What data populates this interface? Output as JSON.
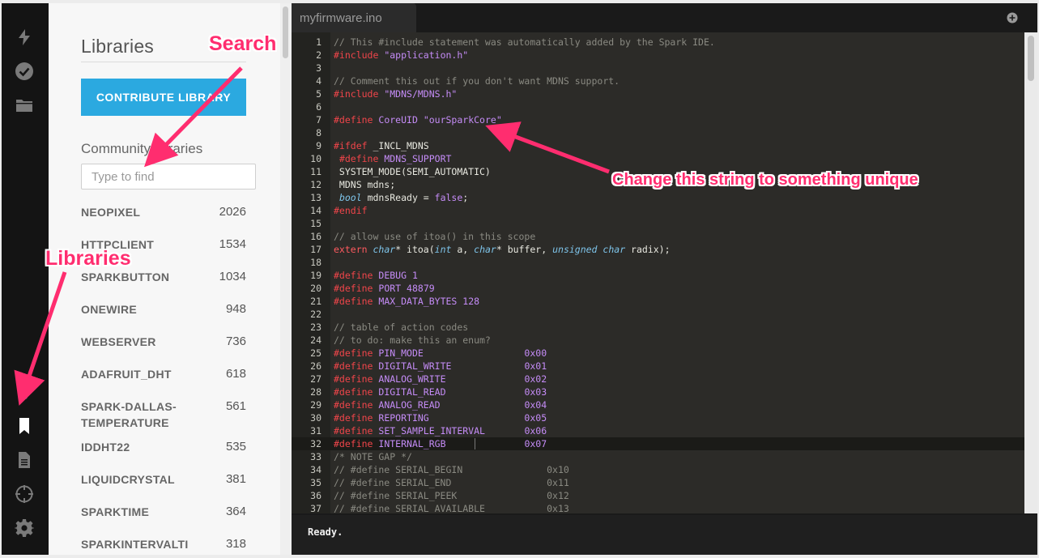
{
  "sidebar": {
    "icons": [
      "flash-icon",
      "verify-check-icon",
      "folder-icon",
      "collapse-chevron-icon",
      "libraries-bookmark-icon",
      "docs-file-icon",
      "target-crosshair-icon",
      "settings-gear-icon"
    ]
  },
  "libraries": {
    "title": "Libraries",
    "contribute_label": "CONTRIBUTE LIBRARY",
    "community_label": "Community libraries",
    "search_placeholder": "Type to find",
    "items": [
      {
        "name": "NEOPIXEL",
        "count": "2026"
      },
      {
        "name": "HTTPCLIENT",
        "count": "1534"
      },
      {
        "name": "SPARKBUTTON",
        "count": "1034"
      },
      {
        "name": "ONEWIRE",
        "count": "948"
      },
      {
        "name": "WEBSERVER",
        "count": "736"
      },
      {
        "name": "ADAFRUIT_DHT",
        "count": "618"
      },
      {
        "name": "SPARK-DALLAS-TEMPERATURE",
        "count": "561"
      },
      {
        "name": "IDDHT22",
        "count": "535"
      },
      {
        "name": "LIQUIDCRYSTAL",
        "count": "381"
      },
      {
        "name": "SPARKTIME",
        "count": "364"
      },
      {
        "name": "SPARKINTERVALTI",
        "count": "318"
      }
    ]
  },
  "editor": {
    "tab_label": "myfirmware.ino",
    "status": "Ready.",
    "lines": [
      "// This #include statement was automatically added by the Spark IDE.",
      "#include \"application.h\"",
      "",
      "// Comment this out if you don't want MDNS support.",
      "#include \"MDNS/MDNS.h\"",
      "",
      "#define CoreUID \"ourSparkCore\"",
      "",
      "#ifdef _INCL_MDNS",
      " #define MDNS_SUPPORT",
      " SYSTEM_MODE(SEMI_AUTOMATIC)",
      " MDNS mdns;",
      " bool mdnsReady = false;",
      "#endif",
      "",
      "// allow use of itoa() in this scope",
      "extern char* itoa(int a, char* buffer, unsigned char radix);",
      "",
      "#define DEBUG 1",
      "#define PORT 48879",
      "#define MAX_DATA_BYTES 128",
      "",
      "// table of action codes",
      "// to do: make this an enum?",
      "#define PIN_MODE                  0x00",
      "#define DIGITAL_WRITE             0x01",
      "#define ANALOG_WRITE              0x02",
      "#define DIGITAL_READ              0x03",
      "#define ANALOG_READ               0x04",
      "#define REPORTING                 0x05",
      "#define SET_SAMPLE_INTERVAL       0x06",
      "#define INTERNAL_RGB              0x07",
      "/* NOTE GAP */",
      "// #define SERIAL_BEGIN               0x10",
      "// #define SERIAL_END                 0x11",
      "// #define SERIAL_PEEK                0x12",
      "// #define SERIAL_AVAILABLE           0x13"
    ]
  },
  "annotations": {
    "search": "Search",
    "libraries": "Libraries",
    "change": "Change this string to something unique"
  },
  "colors": {
    "accent_blue": "#2ba9e0",
    "annotation_pink": "#ff2d6f"
  }
}
